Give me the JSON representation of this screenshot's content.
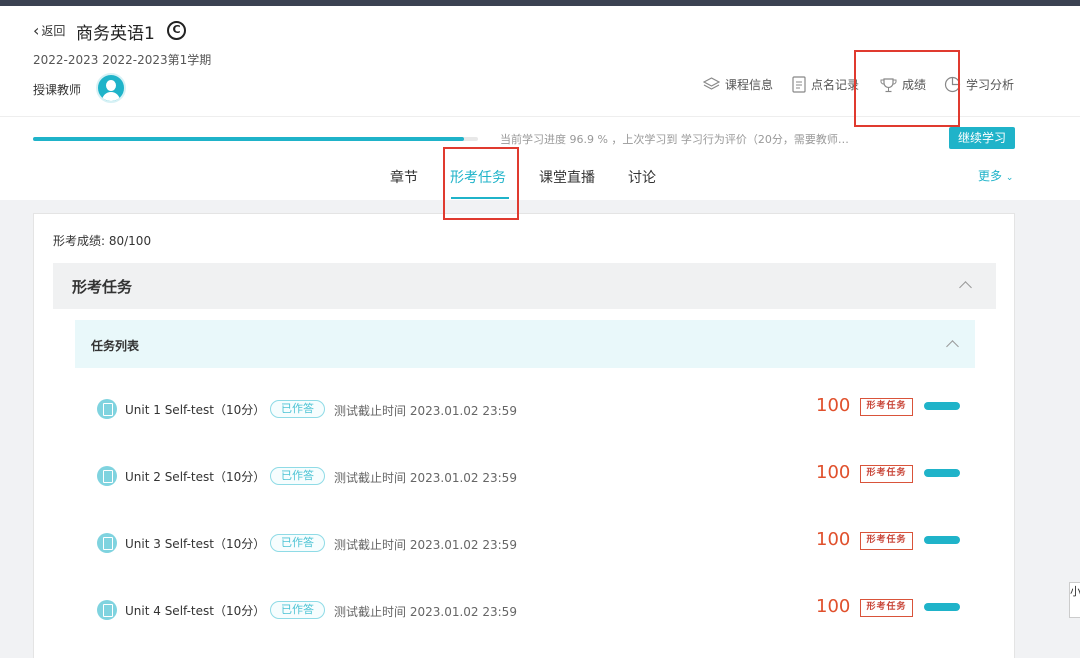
{
  "header": {
    "back_label": "返回",
    "course_title": "商务英语1",
    "copyright_symbol": "C",
    "term": "2022-2023 2022-2023第1学期",
    "teacher_label": "授课教师"
  },
  "top_nav": {
    "course_info": "课程信息",
    "roll_call": "点名记录",
    "grades": "成绩",
    "analysis": "学习分析"
  },
  "progress": {
    "percent": 96.9,
    "text": "当前学习进度 96.9 % ，上次学习到 学习行为评价（20分，需要教师…",
    "continue_label": "继续学习"
  },
  "tabs": {
    "chapter": "章节",
    "formative": "形考任务",
    "live": "课堂直播",
    "discuss": "讨论",
    "more": "更多"
  },
  "card": {
    "score_line": "形考成绩: 80/100",
    "section_title": "形考任务",
    "list_title": "任务列表"
  },
  "tasks": [
    {
      "name": "Unit 1 Self-test（10分）",
      "status": "已作答",
      "deadline_label": "测试截止时间",
      "deadline": "2023.01.02 23:59",
      "score": "100",
      "stamp": "形考任务"
    },
    {
      "name": "Unit 2 Self-test（10分）",
      "status": "已作答",
      "deadline_label": "测试截止时间",
      "deadline": "2023.01.02 23:59",
      "score": "100",
      "stamp": "形考任务"
    },
    {
      "name": "Unit 3 Self-test（10分）",
      "status": "已作答",
      "deadline_label": "测试截止时间",
      "deadline": "2023.01.02 23:59",
      "score": "100",
      "stamp": "形考任务"
    },
    {
      "name": "Unit 4 Self-test（10分）",
      "status": "已作答",
      "deadline_label": "测试截止时间",
      "deadline": "2023.01.02 23:59",
      "score": "100",
      "stamp": "形考任务"
    }
  ],
  "side_tab": "小",
  "colors": {
    "accent": "#1fb3c9",
    "score_red": "#e0502c",
    "highlight_box": "#e03a2f"
  }
}
